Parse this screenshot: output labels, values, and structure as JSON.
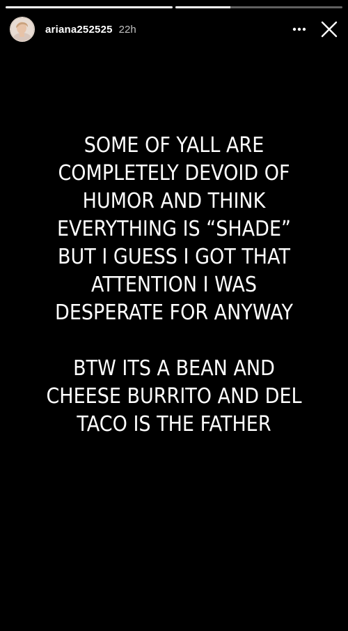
{
  "story": {
    "progress": [
      1.0,
      0.33
    ],
    "user": {
      "username": "ariana252525",
      "timestamp": "22h",
      "avatar_icon": "profile-photo"
    },
    "controls": {
      "more_icon": "more-horizontal-icon",
      "close_icon": "close-icon"
    },
    "text_paragraph_1": "SOME OF YALL ARE\nCOMPLETELY DEVOID OF\nHUMOR AND THINK\nEVERYTHING IS “SHADE”\nBUT I GUESS I GOT THAT\nATTENTION I WAS\nDESPERATE FOR ANYWAY",
    "text_paragraph_2": "BTW ITS A BEAN AND\nCHEESE BURRITO AND DEL\nTACO IS THE FATHER",
    "colors": {
      "background": "#000000",
      "text": "#ffffff"
    }
  }
}
